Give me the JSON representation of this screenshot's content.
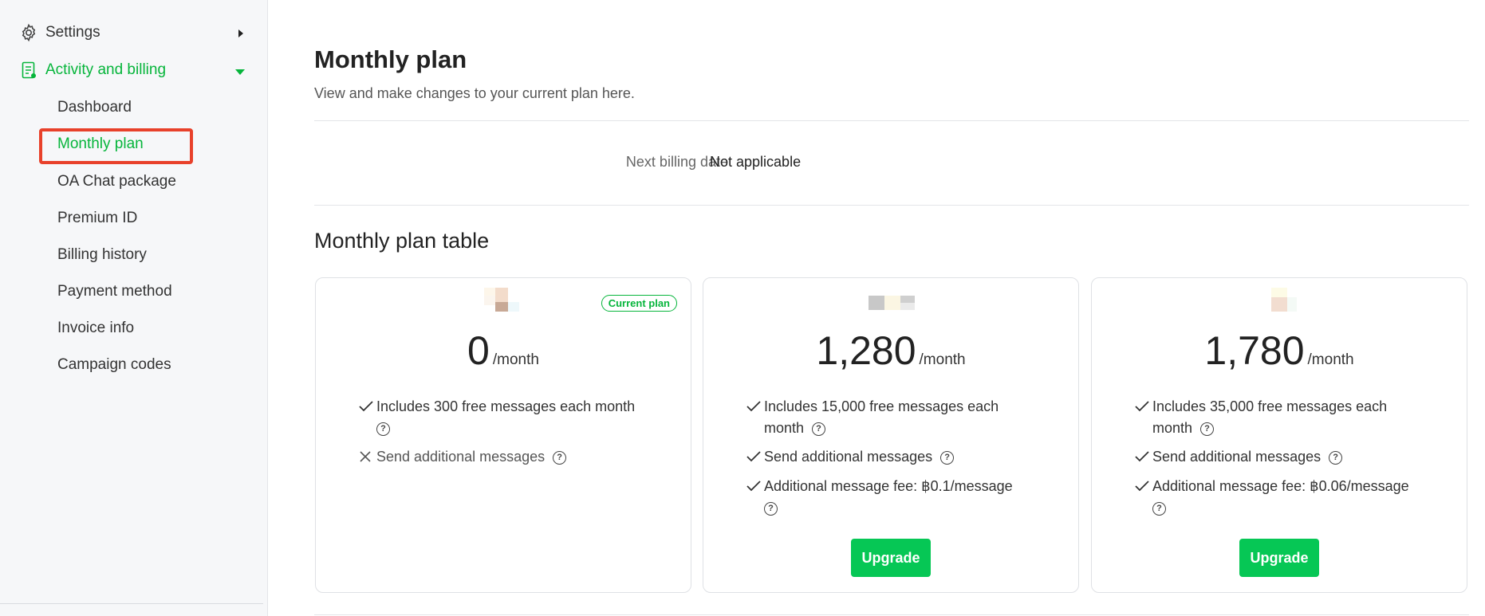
{
  "sidebar": {
    "settings_label": "Settings",
    "activity_label": "Activity and billing",
    "items": [
      {
        "label": "Dashboard"
      },
      {
        "label": "Monthly plan"
      },
      {
        "label": "OA Chat package"
      },
      {
        "label": "Premium ID"
      },
      {
        "label": "Billing history"
      },
      {
        "label": "Payment method"
      },
      {
        "label": "Invoice info"
      },
      {
        "label": "Campaign codes"
      }
    ],
    "active_item": "Monthly plan"
  },
  "page": {
    "title": "Monthly plan",
    "subtitle": "View and make changes to your current plan here.",
    "billing_label": "Next billing date",
    "billing_value": "Not applicable",
    "table_title": "Monthly plan table"
  },
  "plans": [
    {
      "badge": "Current plan",
      "price": "0",
      "per": "/month",
      "features": [
        {
          "text": "Includes 300 free messages each month",
          "included": true
        },
        {
          "text": "Send additional messages",
          "included": false
        }
      ]
    },
    {
      "price": "1,280",
      "per": "/month",
      "button": "Upgrade",
      "features": [
        {
          "text": "Includes 15,000 free messages each month",
          "included": true
        },
        {
          "text": "Send additional messages",
          "included": true
        },
        {
          "text": "Additional message fee: ฿0.1/message",
          "included": true
        }
      ]
    },
    {
      "price": "1,780",
      "per": "/month",
      "button": "Upgrade",
      "features": [
        {
          "text": "Includes 35,000 free messages each month",
          "included": true
        },
        {
          "text": "Send additional messages",
          "included": true
        },
        {
          "text": "Additional message fee: ฿0.06/message",
          "included": true
        }
      ]
    }
  ],
  "help_glyph": "?",
  "colors": {
    "accent": "#06b53b",
    "button": "#06c755",
    "highlight": "#e8412b"
  },
  "icons": {
    "settings": "gear-icon",
    "activity": "document-icon",
    "check": "check-icon",
    "cross": "cross-icon",
    "help": "question-circle-icon"
  }
}
